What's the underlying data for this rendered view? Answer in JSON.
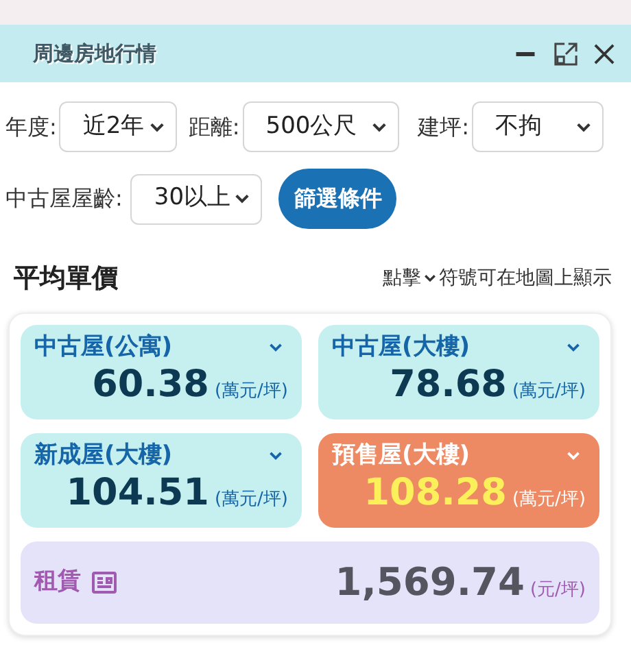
{
  "window": {
    "title": "周邊房地行情"
  },
  "filters": [
    {
      "label": "年度:",
      "value": "近2年"
    },
    {
      "label": "距離:",
      "value": "500公尺"
    },
    {
      "label": "建坪:",
      "value": "不拘"
    },
    {
      "label": "中古屋屋齡:",
      "value": "30以上"
    }
  ],
  "filter_button": "篩選條件",
  "section": {
    "title": "平均單價",
    "hint_before": "點擊",
    "hint_after": "符號可在地圖上顯示"
  },
  "cards": [
    {
      "kind": "resale",
      "title": "中古屋(公寓)",
      "value": "60.38",
      "unit": "(萬元/坪)"
    },
    {
      "kind": "resale",
      "title": "中古屋(大樓)",
      "value": "78.68",
      "unit": "(萬元/坪)"
    },
    {
      "kind": "resale",
      "title": "新成屋(大樓)",
      "value": "104.51",
      "unit": "(萬元/坪)"
    },
    {
      "kind": "presale",
      "title": "預售屋(大樓)",
      "value": "108.28",
      "unit": "(萬元/坪)"
    },
    {
      "kind": "rent",
      "title": "租賃",
      "value": "1,569.74",
      "unit": "(元/坪)"
    }
  ]
}
